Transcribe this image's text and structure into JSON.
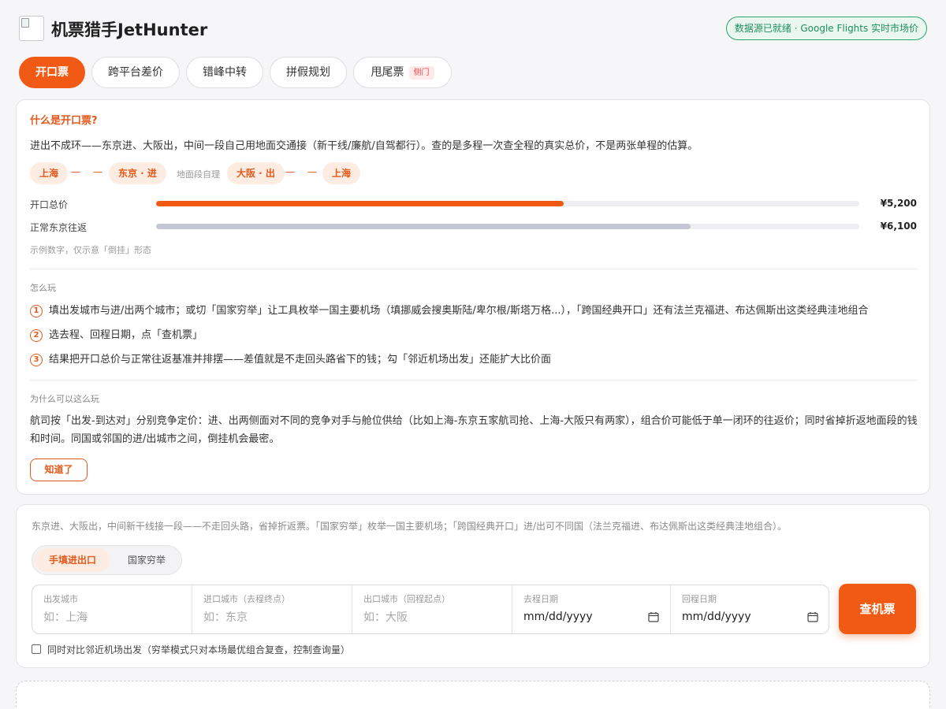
{
  "header": {
    "app_title": "机票猎手JetHunter",
    "status": "数据源已就绪 · Google Flights 实时市场价"
  },
  "tabs": [
    {
      "label": "开口票"
    },
    {
      "label": "跨平台差价"
    },
    {
      "label": "错峰中转"
    },
    {
      "label": "拼假规划"
    },
    {
      "label": "甩尾票",
      "badge": "侧门"
    }
  ],
  "explainer": {
    "title": "什么是开口票?",
    "intro": "进出不成环——东京进、大阪出，中间一段自己用地面交通接（新干线/廉航/自驾都行）。查的是多程一次查全程的真实总价，不是两张单程的估算。",
    "route": {
      "origin": "上海",
      "arrive": "东京 · 进",
      "ground_note": "地面段自理",
      "depart": "大阪 · 出",
      "return": "上海",
      "dash": "—"
    },
    "bars": [
      {
        "label": "开口总价",
        "value_text": "¥5,200",
        "fraction": 0.58,
        "color": "#f05a14"
      },
      {
        "label": "正常东京往返",
        "value_text": "¥6,100",
        "fraction": 0.76,
        "color": "#c5c8d4"
      }
    ],
    "bars_note": "示例数字，仅示意「倒挂」形态",
    "how_title": "怎么玩",
    "steps": [
      {
        "num": "1",
        "text": "填出发城市与进/出两个城市；或切「国家穷举」让工具枚举一国主要机场（填挪威会搜奥斯陆/卑尔根/斯塔万格...），「跨国经典开口」还有法兰克福进、布达佩斯出这类经典洼地组合"
      },
      {
        "num": "2",
        "text": "选去程、回程日期，点「查机票」"
      },
      {
        "num": "3",
        "text": "结果把开口总价与正常往返基准并排摆——差值就是不走回头路省下的钱；勾「邻近机场出发」还能扩大比价面"
      }
    ],
    "why_title": "为什么可以这么玩",
    "why_text": "航司按「出发-到达对」分别竞争定价：进、出两侧面对不同的竞争对手与舱位供给（比如上海-东京五家航司抢、上海-大阪只有两家），组合价可能低于单一闭环的往返价；同时省掉折返地面段的钱和时间。同国或邻国的进/出城市之间，倒挂机会最密。",
    "ok_label": "知道了"
  },
  "search": {
    "note": "东京进、大阪出，中间新干线接一段——不走回头路，省掉折返票。「国家穷举」枚举一国主要机场；「跨国经典开口」进/出可不同国（法兰克福进、布达佩斯出这类经典洼地组合）。",
    "modes": [
      "手填进出口",
      "国家穷举"
    ],
    "fields": [
      {
        "label": "出发城市",
        "placeholder": "如：上海"
      },
      {
        "label": "进口城市（去程终点）",
        "placeholder": "如：东京"
      },
      {
        "label": "出口城市（回程起点）",
        "placeholder": "如：大阪"
      },
      {
        "label": "去程日期",
        "value": "mm/dd/yyyy"
      },
      {
        "label": "回程日期",
        "value": "mm/dd/yyyy"
      }
    ],
    "search_label": "查机票",
    "nearby_label": "同时对比邻近机场出发（穷举模式只对本场最优组合复查，控制查询量）"
  }
}
